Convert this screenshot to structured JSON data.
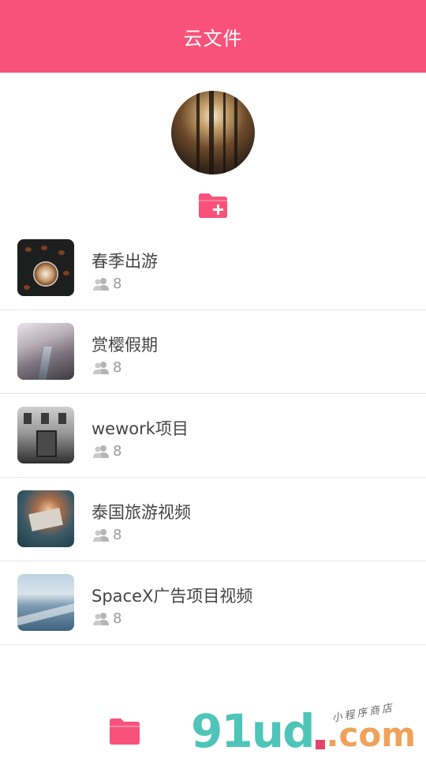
{
  "header": {
    "title": "云文件"
  },
  "profile": {
    "avatar_icon": "forest-photo-avatar"
  },
  "actions": {
    "new_folder_icon": "folder-plus-icon"
  },
  "folders": [
    {
      "name": "春季出游",
      "member_count": "8",
      "thumbnail": "latte-coffee-beans"
    },
    {
      "name": "赏樱假期",
      "member_count": "8",
      "thumbnail": "cherry-blossom-river"
    },
    {
      "name": "wework项目",
      "member_count": "8",
      "thumbnail": "black-white-building"
    },
    {
      "name": "泰国旅游视频",
      "member_count": "8",
      "thumbnail": "floating-box-sky"
    },
    {
      "name": "SpaceX广告项目视频",
      "member_count": "8",
      "thumbnail": "ocean-wave"
    }
  ],
  "bottom_nav": {
    "folder_icon": "folder-icon"
  },
  "watermark": {
    "main": "91ud",
    "suffix": ".com",
    "tagline": "小程序商店"
  },
  "colors": {
    "accent": "#f9527a",
    "muted": "#9a9a9a",
    "divider": "#e6e6e6"
  }
}
